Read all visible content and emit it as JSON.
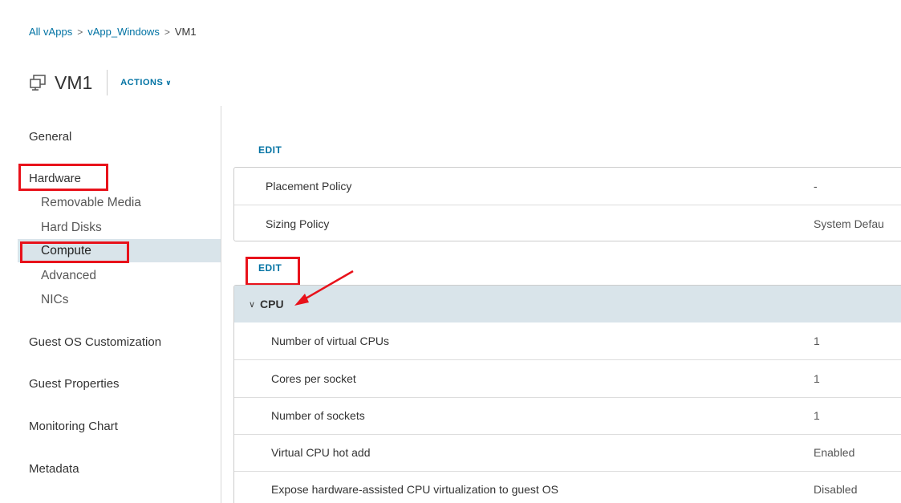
{
  "breadcrumb": {
    "items": [
      "All vApps",
      "vApp_Windows",
      "VM1"
    ],
    "separator": ">"
  },
  "header": {
    "title": "VM1",
    "actions_label": "ACTIONS",
    "icon": "vm-icon"
  },
  "sidebar": {
    "general": "General",
    "hardware": "Hardware",
    "hardware_items": [
      "Removable Media",
      "Hard Disks",
      "Compute",
      "Advanced",
      "NICs"
    ],
    "active_item": "Compute",
    "guest_os": "Guest OS Customization",
    "guest_properties": "Guest Properties",
    "monitoring_chart": "Monitoring Chart",
    "metadata": "Metadata"
  },
  "policies": {
    "edit_label": "EDIT",
    "rows": [
      {
        "label": "Placement Policy",
        "value": "-"
      },
      {
        "label": "Sizing Policy",
        "value": "System Defau"
      }
    ]
  },
  "cpu": {
    "edit_label": "EDIT",
    "section_title": "CPU",
    "rows": [
      {
        "label": "Number of virtual CPUs",
        "value": "1"
      },
      {
        "label": "Cores per socket",
        "value": "1"
      },
      {
        "label": "Number of sockets",
        "value": "1"
      },
      {
        "label": "Virtual CPU hot add",
        "value": "Enabled"
      },
      {
        "label": "Expose hardware-assisted CPU virtualization to guest OS",
        "value": "Disabled"
      }
    ]
  },
  "colors": {
    "link": "#0072a3",
    "active_bg": "#d9e4ea",
    "annotation": "#e8121b"
  }
}
